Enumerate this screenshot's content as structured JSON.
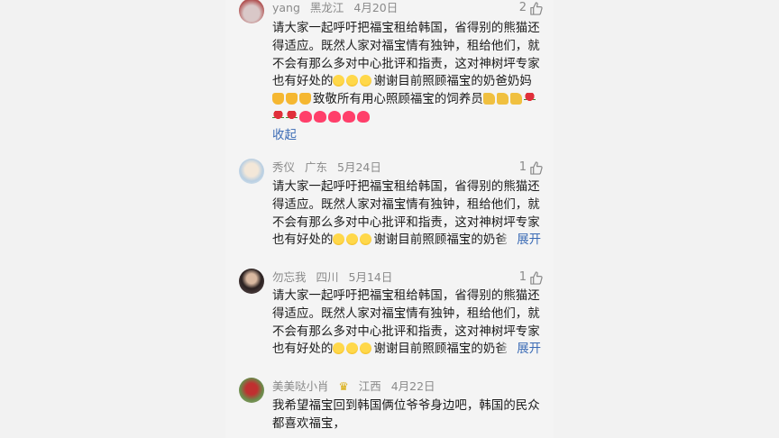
{
  "comments": [
    {
      "user": "yang",
      "region": "黑龙江",
      "date": "4月20日",
      "likes": "2",
      "lines": [
        "请大家一起呼吁把福宝租给韩国，省得别的熊猫还",
        "得适应。既然人家对福宝情有独钟，租给他们，就",
        "不会有那么多对中心批评和指责，这对神树坪专家",
        "谢谢目前照顾福宝的奶爸奶妈",
        "致敬所有用心照顾福宝的饲养员"
      ],
      "line4_prefix": "也有好处的",
      "collapse_label": "收起"
    },
    {
      "user": "秀仪",
      "region": "广东",
      "date": "5月24日",
      "likes": "1",
      "lines": [
        "请大家一起呼吁把福宝租给韩国，省得别的熊猫还",
        "得适应。既然人家对福宝情有独钟，租给他们，就",
        "不会有那么多对中心批评和指责，这对神树坪专家",
        "谢谢目前照顾福宝的奶爸"
      ],
      "line4_prefix": "也有好处的",
      "expand_label": "展开"
    },
    {
      "user": "勿忘我",
      "region": "四川",
      "date": "5月14日",
      "likes": "1",
      "lines": [
        "请大家一起呼吁把福宝租给韩国，省得别的熊猫还",
        "得适应。既然人家对福宝情有独钟，租给他们，就",
        "不会有那么多对中心批评和指责，这对神树坪专家",
        "谢谢目前照顾福宝的奶爸"
      ],
      "line4_prefix": "也有好处的",
      "expand_label": "展开"
    },
    {
      "user": "美美哒小肖",
      "region": "江西",
      "date": "4月22日",
      "lines": [
        "我希望福宝回到韩国俩位爷爷身边吧，韩国的民众",
        "都喜欢福宝，"
      ]
    }
  ],
  "colors": {
    "link": "#3b6bb5",
    "meta": "#8a8a8a",
    "text": "#1a1a1a"
  }
}
